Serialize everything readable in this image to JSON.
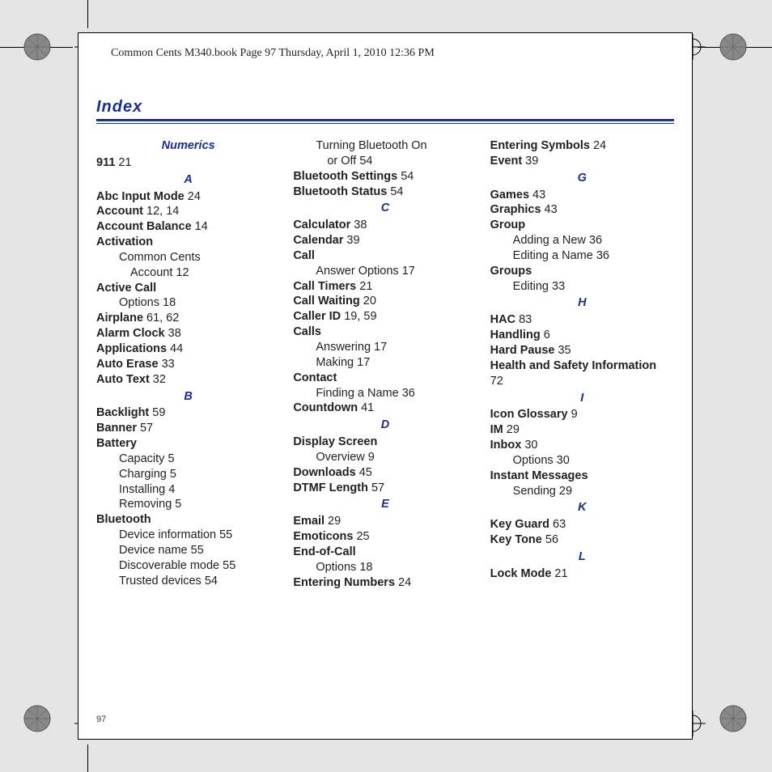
{
  "meta": {
    "header_text": "Common Cents M340.book  Page 97  Thursday, April 1, 2010  12:36 PM",
    "page_number": "97",
    "index_label": "Index"
  },
  "sections": [
    {
      "key": "Numerics",
      "heading": "Numerics",
      "first": true,
      "entries": [
        {
          "term": "911",
          "pages": "21"
        }
      ]
    },
    {
      "key": "A",
      "heading": "A",
      "entries": [
        {
          "term": "Abc Input Mode",
          "pages": "24"
        },
        {
          "term": "Account",
          "pages": "12, 14"
        },
        {
          "term": "Account Balance",
          "pages": "14"
        },
        {
          "term": "Activation",
          "subs": [
            {
              "text": "Common Cents"
            },
            {
              "text": "Account 12",
              "indent": 2
            }
          ]
        },
        {
          "term": "Active Call",
          "subs": [
            {
              "text": "Options 18"
            }
          ]
        },
        {
          "term": "Airplane",
          "pages": "61, 62"
        },
        {
          "term": "Alarm Clock",
          "pages": "38"
        },
        {
          "term": "Applications",
          "pages": "44"
        },
        {
          "term": "Auto Erase",
          "pages": "33"
        },
        {
          "term": "Auto Text",
          "pages": "32"
        }
      ]
    },
    {
      "key": "B",
      "heading": "B",
      "entries": [
        {
          "term": "Backlight",
          "pages": "59"
        },
        {
          "term": "Banner",
          "pages": "57"
        },
        {
          "term": "Battery",
          "subs": [
            {
              "text": "Capacity 5"
            },
            {
              "text": "Charging 5"
            },
            {
              "text": "Installing 4"
            },
            {
              "text": "Removing 5"
            }
          ]
        },
        {
          "term": "Bluetooth",
          "subs": [
            {
              "text": "Device information 55"
            },
            {
              "text": "Device name 55"
            },
            {
              "text": "Discoverable mode 55"
            },
            {
              "text": "Trusted devices 54"
            }
          ]
        }
      ]
    },
    {
      "key": "B2",
      "heading": null,
      "entries": [
        {
          "subs_only": true,
          "subs": [
            {
              "text": "Turning Bluetooth On"
            },
            {
              "text": "or Off 54",
              "indent": 2
            }
          ]
        },
        {
          "term": "Bluetooth Settings",
          "pages": "54"
        },
        {
          "term": "Bluetooth Status",
          "pages": "54"
        }
      ]
    },
    {
      "key": "C",
      "heading": "C",
      "entries": [
        {
          "term": "Calculator",
          "pages": "38"
        },
        {
          "term": "Calendar",
          "pages": "39"
        },
        {
          "term": "Call",
          "subs": [
            {
              "text": "Answer Options 17"
            }
          ]
        },
        {
          "term": "Call Timers",
          "pages": "21"
        },
        {
          "term": "Call Waiting",
          "pages": "20"
        },
        {
          "term": "Caller ID",
          "pages": "19, 59"
        },
        {
          "term": "Calls",
          "subs": [
            {
              "text": "Answering 17"
            },
            {
              "text": "Making 17"
            }
          ]
        },
        {
          "term": "Contact",
          "subs": [
            {
              "text": "Finding a Name 36"
            }
          ]
        },
        {
          "term": "Countdown",
          "pages": "41"
        }
      ]
    },
    {
      "key": "D",
      "heading": "D",
      "entries": [
        {
          "term": "Display Screen",
          "subs": [
            {
              "text": "Overview 9"
            }
          ]
        },
        {
          "term": "Downloads",
          "pages": "45"
        },
        {
          "term": "DTMF Length",
          "pages": "57"
        }
      ]
    },
    {
      "key": "E",
      "heading": "E",
      "entries": [
        {
          "term": "Email",
          "pages": "29"
        },
        {
          "term": "Emoticons",
          "pages": "25"
        },
        {
          "term": "End-of-Call",
          "subs": [
            {
              "text": "Options 18"
            }
          ]
        },
        {
          "term": "Entering Numbers",
          "pages": "24"
        }
      ]
    },
    {
      "key": "E2",
      "heading": null,
      "entries": [
        {
          "term": "Entering Symbols",
          "pages": "24"
        },
        {
          "term": "Event",
          "pages": "39"
        }
      ]
    },
    {
      "key": "G",
      "heading": "G",
      "entries": [
        {
          "term": "Games",
          "pages": "43"
        },
        {
          "term": "Graphics",
          "pages": "43"
        },
        {
          "term": "Group",
          "subs": [
            {
              "text": "Adding a New 36"
            },
            {
              "text": "Editing a Name 36"
            }
          ]
        },
        {
          "term": "Groups",
          "subs": [
            {
              "text": "Editing 33"
            }
          ]
        }
      ]
    },
    {
      "key": "H",
      "heading": "H",
      "entries": [
        {
          "term": "HAC",
          "pages": "83"
        },
        {
          "term": "Handling",
          "pages": "6"
        },
        {
          "term": "Hard Pause",
          "pages": "35"
        },
        {
          "term": "Health and Safety Information",
          "pages_newline": "72"
        }
      ]
    },
    {
      "key": "I",
      "heading": "I",
      "entries": [
        {
          "term": "Icon Glossary",
          "pages": "9"
        },
        {
          "term": "IM",
          "pages": "29"
        },
        {
          "term": "Inbox",
          "pages": "30",
          "subs": [
            {
              "text": "Options 30"
            }
          ]
        },
        {
          "term": "Instant Messages",
          "subs": [
            {
              "text": "Sending 29"
            }
          ]
        }
      ]
    },
    {
      "key": "K",
      "heading": "K",
      "entries": [
        {
          "term": "Key Guard",
          "pages": "63"
        },
        {
          "term": "Key Tone",
          "pages": "56"
        }
      ]
    },
    {
      "key": "L",
      "heading": "L",
      "entries": [
        {
          "term": "Lock Mode",
          "pages": "21"
        }
      ]
    }
  ]
}
